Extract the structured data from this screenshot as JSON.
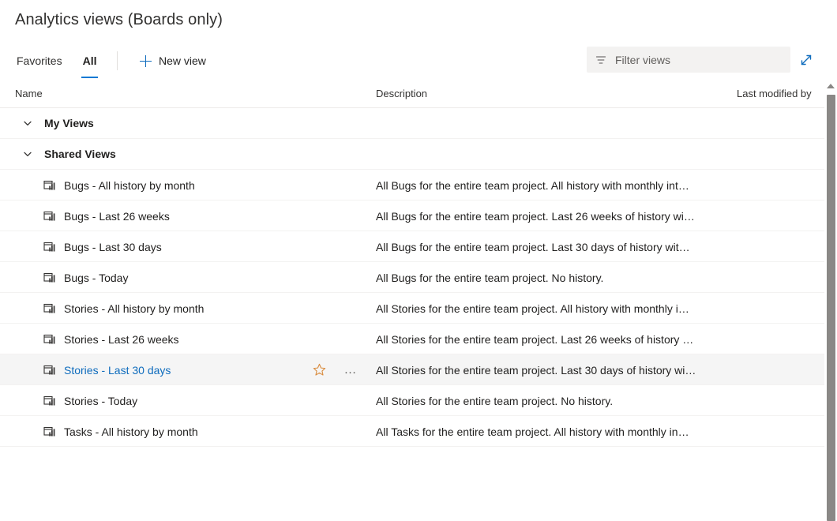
{
  "header": {
    "title": "Analytics views (Boards only)"
  },
  "commandbar": {
    "tabs": [
      {
        "label": "Favorites",
        "active": false
      },
      {
        "label": "All",
        "active": true
      }
    ],
    "new_view_label": "New view",
    "plus_icon": "plus-icon",
    "filter": {
      "placeholder": "Filter views",
      "value": "",
      "icon": "filter-icon"
    },
    "expand_icon": "expand-diagonal-icon",
    "accent_color": "#0078d4",
    "link_color": "#0f6cbd"
  },
  "table": {
    "columns": {
      "name": "Name",
      "description": "Description",
      "last_modified_by": "Last modified by"
    },
    "groups": [
      {
        "label": "My Views",
        "expanded": true,
        "chevron_icon": "chevron-down-icon",
        "rows": []
      },
      {
        "label": "Shared Views",
        "expanded": true,
        "chevron_icon": "chevron-down-icon",
        "rows": [
          {
            "icon": "analytics-view-icon",
            "name": "Bugs - All history by month",
            "description": "All Bugs for the entire team project. All history with monthly int…",
            "hovered": false
          },
          {
            "icon": "analytics-view-icon",
            "name": "Bugs - Last 26 weeks",
            "description": "All Bugs for the entire team project. Last 26 weeks of history wi…",
            "hovered": false
          },
          {
            "icon": "analytics-view-icon",
            "name": "Bugs - Last 30 days",
            "description": "All Bugs for the entire team project. Last 30 days of history wit…",
            "hovered": false
          },
          {
            "icon": "analytics-view-icon",
            "name": "Bugs - Today",
            "description": "All Bugs for the entire team project. No history.",
            "hovered": false
          },
          {
            "icon": "analytics-view-icon",
            "name": "Stories - All history by month",
            "description": "All Stories for the entire team project. All history with monthly i…",
            "hovered": false
          },
          {
            "icon": "analytics-view-icon",
            "name": "Stories - Last 26 weeks",
            "description": "All Stories for the entire team project. Last 26 weeks of history …",
            "hovered": false
          },
          {
            "icon": "analytics-view-icon",
            "name": "Stories - Last 30 days",
            "description": "All Stories for the entire team project. Last 30 days of history wi…",
            "hovered": true,
            "star_icon": "star-outline-icon",
            "star_color": "#d98c3f",
            "more_icon": "more-ellipsis-icon",
            "more_label": "…"
          },
          {
            "icon": "analytics-view-icon",
            "name": "Stories - Today",
            "description": "All Stories for the entire team project. No history.",
            "hovered": false
          },
          {
            "icon": "analytics-view-icon",
            "name": "Tasks - All history by month",
            "description": "All Tasks for the entire team project. All history with monthly in…",
            "hovered": false
          }
        ]
      }
    ]
  },
  "scrollbar": {
    "up_icon": "scroll-up-arrow-icon",
    "thumb": "scroll-thumb"
  }
}
